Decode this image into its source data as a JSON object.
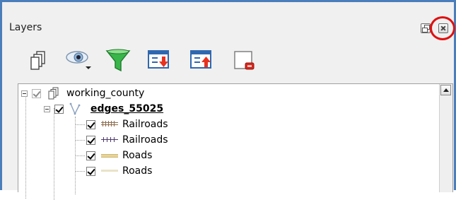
{
  "dock": {
    "title": "Layers"
  },
  "toolbar": {
    "buttons": [
      {
        "icon": "add-group-icon"
      },
      {
        "icon": "manage-visibility-icon"
      },
      {
        "icon": "filter-legend-icon"
      },
      {
        "icon": "expand-all-icon"
      },
      {
        "icon": "collapse-all-icon"
      },
      {
        "icon": "remove-layer-icon"
      }
    ]
  },
  "tree": {
    "group": {
      "label": "working_county",
      "checked": true
    },
    "layer": {
      "label": "edges_55025",
      "checked": true
    },
    "classes": [
      {
        "label": "Railroads",
        "symbol": "railroad-symbol-1",
        "checked": true
      },
      {
        "label": "Railroads",
        "symbol": "railroad-symbol-2",
        "checked": true
      },
      {
        "label": "Roads",
        "symbol": "road-symbol-1",
        "checked": true
      },
      {
        "label": "Roads",
        "symbol": "road-symbol-2",
        "checked": true
      }
    ]
  },
  "colors": {
    "frame_border": "#4a7ebb",
    "highlight_circle": "#e01010",
    "panel_bg": "#f0f0f0"
  }
}
